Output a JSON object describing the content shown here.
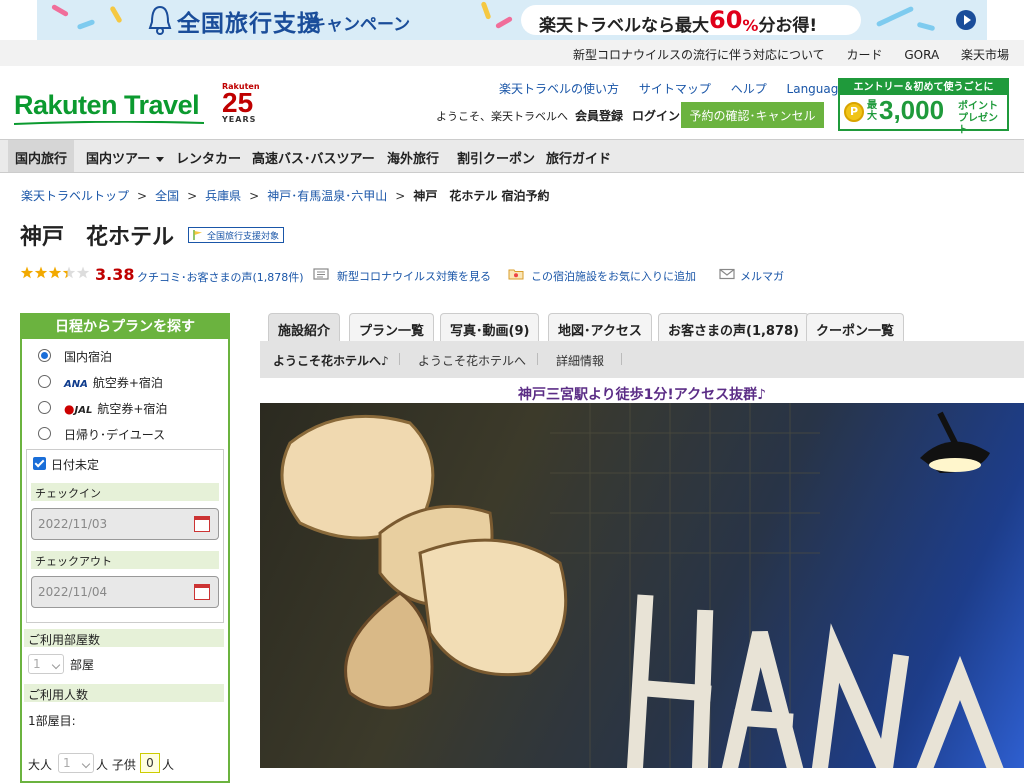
{
  "banner": {
    "main_title": "全国旅行支援",
    "sub_title": "キャンペーン",
    "pill_prefix": "楽天トラベルなら最大",
    "pill_number": "60",
    "pill_pct": "%",
    "pill_suffix": "分お得!"
  },
  "utility_links": [
    "新型コロナウイルスの流行に伴う対応について",
    "カード",
    "GORA",
    "楽天市場"
  ],
  "header": {
    "logo": "Rakuten Travel",
    "anniv_brand": "Rakuten",
    "anniv_number": "25",
    "anniv_years": "YEARS",
    "links": [
      "楽天トラベルの使い方",
      "サイトマップ",
      "ヘルプ"
    ],
    "languages": "Languages",
    "welcome": "ようこそ、楽天トラベルへ",
    "register": "会員登録",
    "login": "ログイン",
    "confirm_button": "予約の確認･キャンセル",
    "promo_top": "エントリー＆初めて使うごとに",
    "promo_coin": "P",
    "promo_max": "最大",
    "promo_amount": "3,000",
    "promo_points_1": "ポイント",
    "promo_points_2": "プレゼント"
  },
  "nav": {
    "items": [
      "国内旅行",
      "国内ツアー",
      "レンタカー",
      "高速バス･バスツアー",
      "海外旅行",
      "割引クーポン",
      "旅行ガイド"
    ]
  },
  "breadcrumb": {
    "items": [
      "楽天トラベルトップ",
      "全国",
      "兵庫県",
      "神戸･有馬温泉･六甲山"
    ],
    "separator": ">",
    "current": "神戸　花ホテル 宿泊予約"
  },
  "hotel": {
    "name": "神戸　花ホテル",
    "badge": "全国旅行支援対象",
    "rating": 3.38,
    "score_text": "3.38",
    "reviews": "クチコミ･お客さまの声(1,878件)",
    "covid_link": "新型コロナウイルス対策を見る",
    "favorite_link": "この宿泊施設をお気に入りに追加",
    "mail_link": "メルマガ"
  },
  "search": {
    "title": "日程からプランを探す",
    "options": [
      "国内宿泊",
      "航空券+宿泊",
      "航空券+宿泊",
      "日帰り･デイユース"
    ],
    "ana": "ANA",
    "jal": "JAL",
    "date_undecided": "日付未定",
    "checkin_label": "チェックイン",
    "checkin_value": "2022/11/03",
    "checkout_label": "チェックアウト",
    "checkout_value": "2022/11/04",
    "rooms_label": "ご利用部屋数",
    "rooms_value": "1",
    "rooms_unit": "部屋",
    "guests_label": "ご利用人数",
    "room1": "1部屋目:",
    "adult": "大人",
    "adult_value": "1",
    "adult_unit": "人 子供",
    "child_value": "0",
    "child_unit": "人"
  },
  "tabs": [
    "施設紹介",
    "プラン一覧",
    "写真･動画(9)",
    "地図･アクセス",
    "お客さまの声(1,878)",
    "クーポン一覧"
  ],
  "subnav": [
    "ようこそ花ホテルへ♪",
    "ようこそ花ホテルへ",
    "詳細情報"
  ],
  "catchphrase": "神戸三宮駅より徒歩1分!アクセス抜群♪",
  "colors": {
    "brand_green": "#0b9a2f",
    "accent_green": "#6bb33f",
    "link_blue": "#1a56a8",
    "score_red": "#bf0000"
  }
}
